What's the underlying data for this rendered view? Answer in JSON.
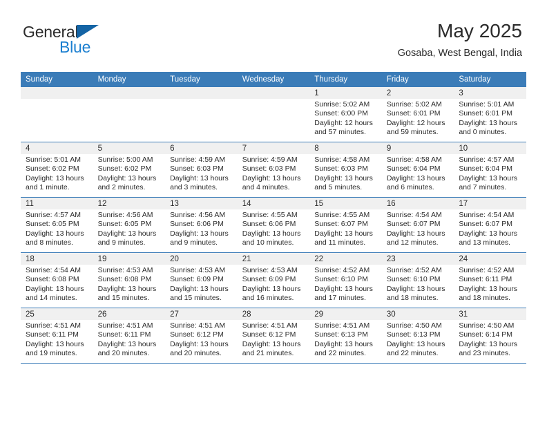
{
  "brand": {
    "name_top": "General",
    "name_bottom": "Blue",
    "triangle_color": "#1464a5",
    "blue_color": "#1b7fd0"
  },
  "header": {
    "month_title": "May 2025",
    "location": "Gosaba, West Bengal, India"
  },
  "theme": {
    "header_blue": "#3b7cb8",
    "date_band": "#f0f0f0",
    "text": "#2b2b2b"
  },
  "weekday_headers": [
    "Sunday",
    "Monday",
    "Tuesday",
    "Wednesday",
    "Thursday",
    "Friday",
    "Saturday"
  ],
  "weeks": [
    [
      {
        "day": "",
        "sunrise": "",
        "sunset": "",
        "daylight_line1": "",
        "daylight_line2": ""
      },
      {
        "day": "",
        "sunrise": "",
        "sunset": "",
        "daylight_line1": "",
        "daylight_line2": ""
      },
      {
        "day": "",
        "sunrise": "",
        "sunset": "",
        "daylight_line1": "",
        "daylight_line2": ""
      },
      {
        "day": "",
        "sunrise": "",
        "sunset": "",
        "daylight_line1": "",
        "daylight_line2": ""
      },
      {
        "day": "1",
        "sunrise": "Sunrise: 5:02 AM",
        "sunset": "Sunset: 6:00 PM",
        "daylight_line1": "Daylight: 12 hours",
        "daylight_line2": "and 57 minutes."
      },
      {
        "day": "2",
        "sunrise": "Sunrise: 5:02 AM",
        "sunset": "Sunset: 6:01 PM",
        "daylight_line1": "Daylight: 12 hours",
        "daylight_line2": "and 59 minutes."
      },
      {
        "day": "3",
        "sunrise": "Sunrise: 5:01 AM",
        "sunset": "Sunset: 6:01 PM",
        "daylight_line1": "Daylight: 13 hours",
        "daylight_line2": "and 0 minutes."
      }
    ],
    [
      {
        "day": "4",
        "sunrise": "Sunrise: 5:01 AM",
        "sunset": "Sunset: 6:02 PM",
        "daylight_line1": "Daylight: 13 hours",
        "daylight_line2": "and 1 minute."
      },
      {
        "day": "5",
        "sunrise": "Sunrise: 5:00 AM",
        "sunset": "Sunset: 6:02 PM",
        "daylight_line1": "Daylight: 13 hours",
        "daylight_line2": "and 2 minutes."
      },
      {
        "day": "6",
        "sunrise": "Sunrise: 4:59 AM",
        "sunset": "Sunset: 6:03 PM",
        "daylight_line1": "Daylight: 13 hours",
        "daylight_line2": "and 3 minutes."
      },
      {
        "day": "7",
        "sunrise": "Sunrise: 4:59 AM",
        "sunset": "Sunset: 6:03 PM",
        "daylight_line1": "Daylight: 13 hours",
        "daylight_line2": "and 4 minutes."
      },
      {
        "day": "8",
        "sunrise": "Sunrise: 4:58 AM",
        "sunset": "Sunset: 6:03 PM",
        "daylight_line1": "Daylight: 13 hours",
        "daylight_line2": "and 5 minutes."
      },
      {
        "day": "9",
        "sunrise": "Sunrise: 4:58 AM",
        "sunset": "Sunset: 6:04 PM",
        "daylight_line1": "Daylight: 13 hours",
        "daylight_line2": "and 6 minutes."
      },
      {
        "day": "10",
        "sunrise": "Sunrise: 4:57 AM",
        "sunset": "Sunset: 6:04 PM",
        "daylight_line1": "Daylight: 13 hours",
        "daylight_line2": "and 7 minutes."
      }
    ],
    [
      {
        "day": "11",
        "sunrise": "Sunrise: 4:57 AM",
        "sunset": "Sunset: 6:05 PM",
        "daylight_line1": "Daylight: 13 hours",
        "daylight_line2": "and 8 minutes."
      },
      {
        "day": "12",
        "sunrise": "Sunrise: 4:56 AM",
        "sunset": "Sunset: 6:05 PM",
        "daylight_line1": "Daylight: 13 hours",
        "daylight_line2": "and 9 minutes."
      },
      {
        "day": "13",
        "sunrise": "Sunrise: 4:56 AM",
        "sunset": "Sunset: 6:06 PM",
        "daylight_line1": "Daylight: 13 hours",
        "daylight_line2": "and 9 minutes."
      },
      {
        "day": "14",
        "sunrise": "Sunrise: 4:55 AM",
        "sunset": "Sunset: 6:06 PM",
        "daylight_line1": "Daylight: 13 hours",
        "daylight_line2": "and 10 minutes."
      },
      {
        "day": "15",
        "sunrise": "Sunrise: 4:55 AM",
        "sunset": "Sunset: 6:07 PM",
        "daylight_line1": "Daylight: 13 hours",
        "daylight_line2": "and 11 minutes."
      },
      {
        "day": "16",
        "sunrise": "Sunrise: 4:54 AM",
        "sunset": "Sunset: 6:07 PM",
        "daylight_line1": "Daylight: 13 hours",
        "daylight_line2": "and 12 minutes."
      },
      {
        "day": "17",
        "sunrise": "Sunrise: 4:54 AM",
        "sunset": "Sunset: 6:07 PM",
        "daylight_line1": "Daylight: 13 hours",
        "daylight_line2": "and 13 minutes."
      }
    ],
    [
      {
        "day": "18",
        "sunrise": "Sunrise: 4:54 AM",
        "sunset": "Sunset: 6:08 PM",
        "daylight_line1": "Daylight: 13 hours",
        "daylight_line2": "and 14 minutes."
      },
      {
        "day": "19",
        "sunrise": "Sunrise: 4:53 AM",
        "sunset": "Sunset: 6:08 PM",
        "daylight_line1": "Daylight: 13 hours",
        "daylight_line2": "and 15 minutes."
      },
      {
        "day": "20",
        "sunrise": "Sunrise: 4:53 AM",
        "sunset": "Sunset: 6:09 PM",
        "daylight_line1": "Daylight: 13 hours",
        "daylight_line2": "and 15 minutes."
      },
      {
        "day": "21",
        "sunrise": "Sunrise: 4:53 AM",
        "sunset": "Sunset: 6:09 PM",
        "daylight_line1": "Daylight: 13 hours",
        "daylight_line2": "and 16 minutes."
      },
      {
        "day": "22",
        "sunrise": "Sunrise: 4:52 AM",
        "sunset": "Sunset: 6:10 PM",
        "daylight_line1": "Daylight: 13 hours",
        "daylight_line2": "and 17 minutes."
      },
      {
        "day": "23",
        "sunrise": "Sunrise: 4:52 AM",
        "sunset": "Sunset: 6:10 PM",
        "daylight_line1": "Daylight: 13 hours",
        "daylight_line2": "and 18 minutes."
      },
      {
        "day": "24",
        "sunrise": "Sunrise: 4:52 AM",
        "sunset": "Sunset: 6:11 PM",
        "daylight_line1": "Daylight: 13 hours",
        "daylight_line2": "and 18 minutes."
      }
    ],
    [
      {
        "day": "25",
        "sunrise": "Sunrise: 4:51 AM",
        "sunset": "Sunset: 6:11 PM",
        "daylight_line1": "Daylight: 13 hours",
        "daylight_line2": "and 19 minutes."
      },
      {
        "day": "26",
        "sunrise": "Sunrise: 4:51 AM",
        "sunset": "Sunset: 6:11 PM",
        "daylight_line1": "Daylight: 13 hours",
        "daylight_line2": "and 20 minutes."
      },
      {
        "day": "27",
        "sunrise": "Sunrise: 4:51 AM",
        "sunset": "Sunset: 6:12 PM",
        "daylight_line1": "Daylight: 13 hours",
        "daylight_line2": "and 20 minutes."
      },
      {
        "day": "28",
        "sunrise": "Sunrise: 4:51 AM",
        "sunset": "Sunset: 6:12 PM",
        "daylight_line1": "Daylight: 13 hours",
        "daylight_line2": "and 21 minutes."
      },
      {
        "day": "29",
        "sunrise": "Sunrise: 4:51 AM",
        "sunset": "Sunset: 6:13 PM",
        "daylight_line1": "Daylight: 13 hours",
        "daylight_line2": "and 22 minutes."
      },
      {
        "day": "30",
        "sunrise": "Sunrise: 4:50 AM",
        "sunset": "Sunset: 6:13 PM",
        "daylight_line1": "Daylight: 13 hours",
        "daylight_line2": "and 22 minutes."
      },
      {
        "day": "31",
        "sunrise": "Sunrise: 4:50 AM",
        "sunset": "Sunset: 6:14 PM",
        "daylight_line1": "Daylight: 13 hours",
        "daylight_line2": "and 23 minutes."
      }
    ]
  ]
}
